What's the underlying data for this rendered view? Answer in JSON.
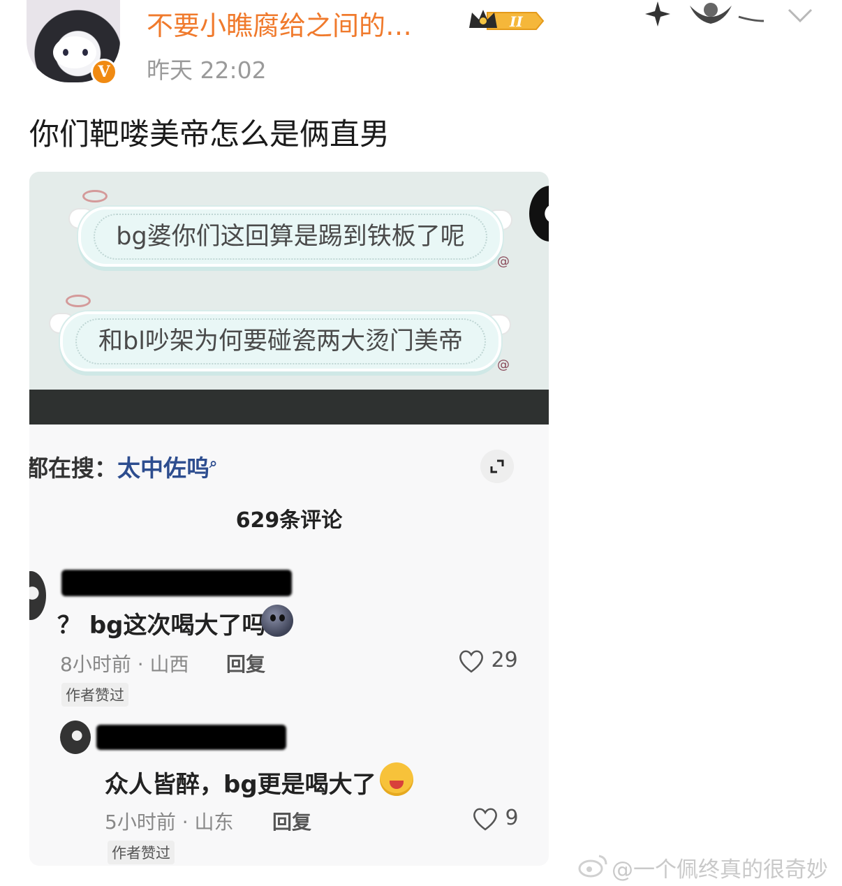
{
  "post": {
    "username": "不要小瞧腐给之间的…",
    "badge_level": "II",
    "verified_mark": "V",
    "timestamp": "昨天 22:02",
    "text": "你们靶喽美帝怎么是俩直男"
  },
  "screenshot": {
    "bubble1": "bg婆你们这回算是踢到铁板了呢",
    "bubble2": "和bl吵架为何要碰瓷两大烫门美帝",
    "search_prefix": "都在搜：",
    "search_keyword": "太中佐呜",
    "comments_count": "629条评论",
    "comments": [
      {
        "text": "？ bg这次喝大了吗",
        "meta": "8小时前 · 山西",
        "reply": "回复",
        "tag": "作者赞过",
        "likes": "29"
      },
      {
        "text": "众人皆醉，bg更是喝大了",
        "meta": "5小时前 · 山东",
        "reply": "回复",
        "tag": "作者赞过",
        "likes": "9"
      }
    ]
  },
  "watermark": "@一个佩终真的很奇妙",
  "icons": {
    "crown": "crown-icon",
    "chevron": "chevron-down-icon",
    "expand": "expand-icon",
    "heart": "heart-icon",
    "search": "search-icon",
    "weibo_logo": "weibo-logo-icon"
  },
  "colors": {
    "username": "#f07a2c",
    "verified": "#f08a12",
    "keyword": "#2d4d8f"
  }
}
